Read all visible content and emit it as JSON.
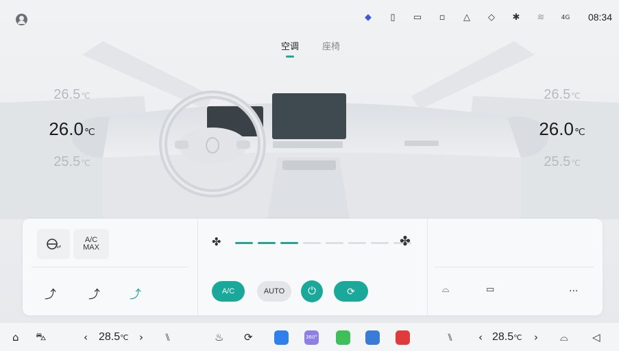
{
  "status": {
    "time": "08:34",
    "icons": [
      "navigation-icon",
      "vibration-icon",
      "phone-icon",
      "sim-icon",
      "bell-icon",
      "shield-icon",
      "bluetooth-icon",
      "wifi-icon",
      "signal-4g-icon"
    ],
    "network_label": "4G"
  },
  "tabs": [
    {
      "label": "空调",
      "active": true
    },
    {
      "label": "座椅",
      "active": false
    }
  ],
  "climate": {
    "left": {
      "upper": "26.5",
      "current": "26.0",
      "lower": "25.5",
      "unit": "℃"
    },
    "right": {
      "upper": "26.5",
      "current": "26.0",
      "lower": "25.5",
      "unit": "℃"
    }
  },
  "controls": {
    "ac_max_line1": "A/C",
    "ac_max_line2": "MAX",
    "fan_level": 3,
    "fan_levels_total": 8,
    "ac_label": "A/C",
    "auto_label": "AUTO",
    "more_label": "···"
  },
  "dock": {
    "left_temp": "28.5",
    "right_temp": "28.5",
    "unit": "℃",
    "app_360_label": "360°"
  },
  "colors": {
    "accent": "#1aa89a",
    "inactive": "#e3e5e8"
  }
}
